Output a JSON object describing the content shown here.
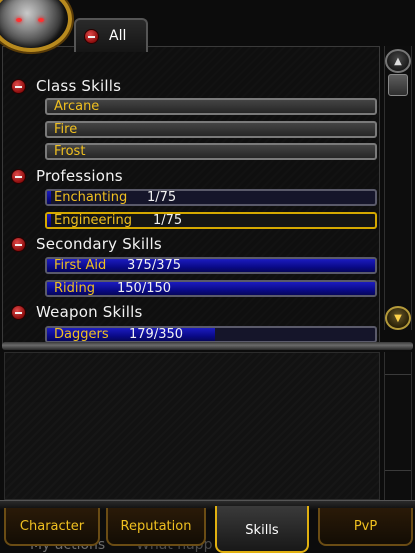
{
  "filter_tab": {
    "label": "All"
  },
  "categories": [
    {
      "label": "Class Skills",
      "skills": [
        {
          "name": "Arcane",
          "rank": "",
          "style": "gray",
          "fill": 0
        },
        {
          "name": "Fire",
          "rank": "",
          "style": "gray",
          "fill": 0
        },
        {
          "name": "Frost",
          "rank": "",
          "style": "gray",
          "fill": 0
        }
      ]
    },
    {
      "label": "Professions",
      "skills": [
        {
          "name": "Enchanting",
          "rank": "1/75",
          "style": "blue",
          "fill": 0.013
        },
        {
          "name": "Engineering",
          "rank": "1/75",
          "style": "selected",
          "fill": 0.013
        }
      ]
    },
    {
      "label": "Secondary Skills",
      "skills": [
        {
          "name": "First Aid",
          "rank": "375/375",
          "style": "blue",
          "fill": 1.0
        },
        {
          "name": "Riding",
          "rank": "150/150",
          "style": "blue",
          "fill": 1.0
        }
      ]
    },
    {
      "label": "Weapon Skills",
      "skills": [
        {
          "name": "Daggers",
          "rank": "179/350",
          "style": "blue",
          "fill": 0.511
        }
      ]
    }
  ],
  "scrollbar": {
    "up_icon": "scroll-up-icon",
    "down_icon": "scroll-down-icon"
  },
  "background_chat": {
    "left": "My actions",
    "right": "What happ"
  },
  "bottom_tabs": {
    "character": "Character",
    "reputation": "Reputation",
    "skills": "Skills",
    "pvp": "PvP",
    "active": "Skills"
  },
  "colors": {
    "skill_name": "#f0c020",
    "fill_blue": "#1c1cc0",
    "selected_border": "#d5a800",
    "minus_icon": "#c0201e"
  }
}
